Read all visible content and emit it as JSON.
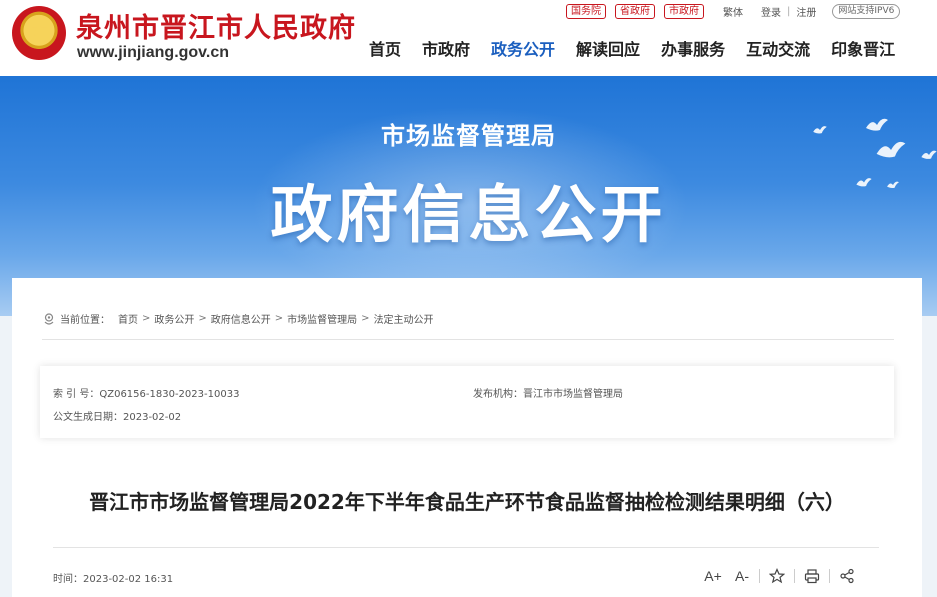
{
  "header": {
    "site_title": "泉州市晋江市人民政府",
    "site_url": "www.jinjiang.gov.cn",
    "top_links": {
      "guowuyuan": "国务院",
      "shengzhengfu": "省政府",
      "shizhengfu": "市政府",
      "traditional": "繁体",
      "login": "登录",
      "register": "注册",
      "ipv6": "网站支持IPV6"
    },
    "nav": [
      {
        "label": "首页"
      },
      {
        "label": "市政府"
      },
      {
        "label": "政务公开"
      },
      {
        "label": "解读回应"
      },
      {
        "label": "办事服务"
      },
      {
        "label": "互动交流"
      },
      {
        "label": "印象晋江"
      }
    ]
  },
  "banner": {
    "subtitle": "市场监督管理局",
    "title": "政府信息公开"
  },
  "breadcrumb": {
    "label": "当前位置：",
    "items": [
      "首页",
      "政务公开",
      "政府信息公开",
      "市场监督管理局",
      "法定主动公开"
    ],
    "separator": ">"
  },
  "meta": {
    "index_label": "索 引 号：",
    "index_value": "QZ06156-1830-2023-10033",
    "publisher_label": "发布机构：",
    "publisher_value": "晋江市市场监督管理局",
    "date_label": "公文生成日期：",
    "date_value": "2023-02-02"
  },
  "article": {
    "title": "晋江市市场监督管理局2022年下半年食品生产环节食品监督抽检检测结果明细（六）",
    "time_label": "时间：",
    "time_value": "2023-02-02 16:31",
    "tools": {
      "font_up": "A+",
      "font_down": "A-"
    }
  },
  "colors": {
    "brand_red": "#c8161e",
    "nav_active": "#1b5fbf",
    "banner_blue": "#1f74d6"
  },
  "icons": [
    "emblem-icon",
    "location-icon",
    "font-increase-icon",
    "font-decrease-icon",
    "star-icon",
    "print-icon",
    "share-icon",
    "dove-icon"
  ]
}
